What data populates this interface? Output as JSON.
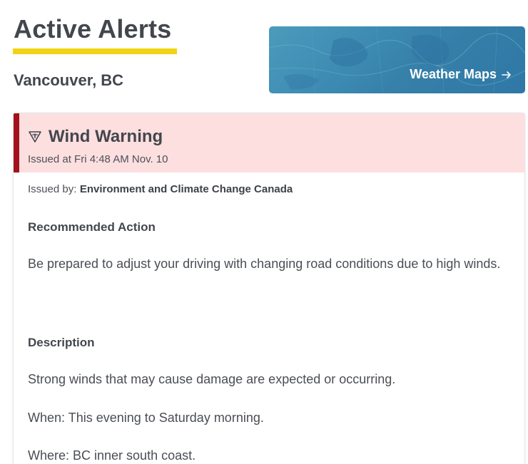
{
  "header": {
    "title": "Active Alerts",
    "location": "Vancouver, BC"
  },
  "maps_banner": {
    "label": "Weather Maps",
    "arrow": "→",
    "icon": "arrow-right-icon"
  },
  "alert": {
    "icon": "warning-triangle-icon",
    "title": "Wind Warning",
    "issued_at": "Issued at Fri 4:48 AM Nov. 10",
    "issued_by_label": "Issued by:",
    "issued_by_value": "Environment and Climate Change Canada",
    "recommended_heading": "Recommended Action",
    "recommended_text": "Be prepared to adjust your driving with changing road conditions due to high winds.",
    "description_heading": "Description",
    "description_lines": [
      "Strong winds that may cause damage are expected or occurring.",
      "When: This evening to Saturday morning.",
      "Where: BC inner south coast."
    ]
  },
  "colors": {
    "accent_yellow": "#f2d313",
    "alert_red": "#a3121c",
    "alert_bg": "#fddfe0",
    "banner_blue": "#3d8bb3"
  }
}
